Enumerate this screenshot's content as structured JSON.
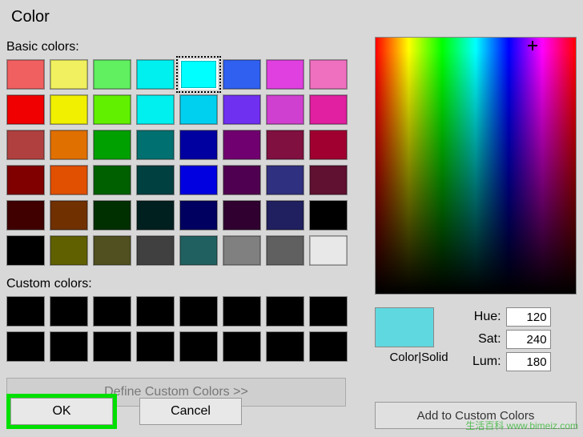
{
  "title": "Color",
  "sections": {
    "basic_label": "Basic colors:",
    "custom_label": "Custom colors:"
  },
  "basic_colors": [
    "#f06060",
    "#f0f060",
    "#60f060",
    "#00f0f0",
    "#00ffff",
    "#3060f0",
    "#e040e0",
    "#f070c0",
    "#f00000",
    "#f0f000",
    "#60f000",
    "#00f0f0",
    "#00d0f0",
    "#7030f0",
    "#d040d0",
    "#e020a0",
    "#b04040",
    "#e07000",
    "#00a000",
    "#007070",
    "#0000a0",
    "#700070",
    "#801040",
    "#a00030",
    "#800000",
    "#e05000",
    "#006000",
    "#004040",
    "#0000e0",
    "#500050",
    "#303080",
    "#601030",
    "#400000",
    "#703000",
    "#003000",
    "#002020",
    "#000060",
    "#300030",
    "#202060",
    "#000000",
    "#000000",
    "#606000",
    "#505020",
    "#404040",
    "#206060",
    "#808080",
    "#606060",
    "#e8e8e8"
  ],
  "selected_basic_index": 4,
  "custom_colors": [
    "#000000",
    "#000000",
    "#000000",
    "#000000",
    "#000000",
    "#000000",
    "#000000",
    "#000000",
    "#000000",
    "#000000",
    "#000000",
    "#000000",
    "#000000",
    "#000000",
    "#000000",
    "#000000"
  ],
  "define_button": "Define Custom Colors >>",
  "buttons": {
    "ok": "OK",
    "cancel": "Cancel",
    "add": "Add to Custom Colors"
  },
  "preview_color": "#60d8e0",
  "color_solid_label": "Color|Solid",
  "hsl": {
    "hue_label": "Hue:",
    "hue_value": "120",
    "sat_label": "Sat:",
    "sat_value": "240",
    "lum_label": "Lum:",
    "lum_value": "180"
  },
  "watermark": "生活百科\nwww.bimeiz.com"
}
